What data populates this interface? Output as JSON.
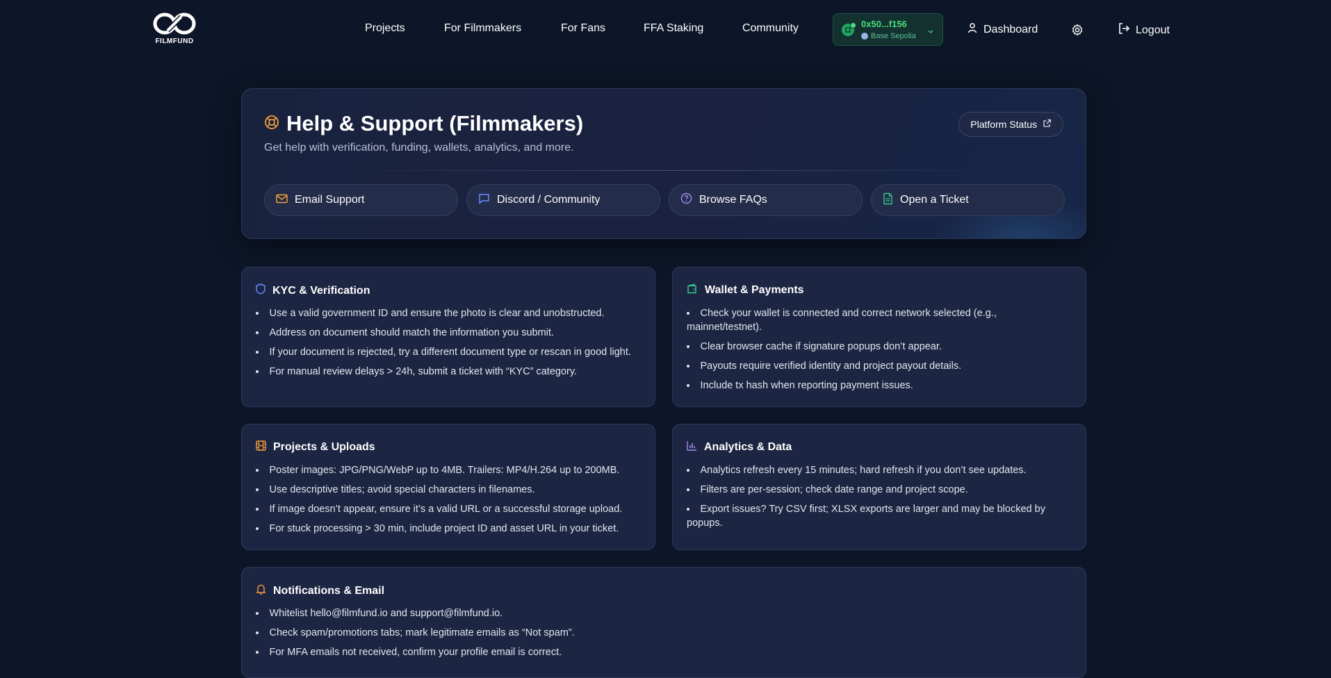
{
  "brand": {
    "logo_text": "FILMFUND"
  },
  "nav": {
    "links": [
      "Projects",
      "For Filmmakers",
      "For Fans",
      "FFA Staking",
      "Community"
    ],
    "wallet": {
      "address": "0x50...f156",
      "network": "Base Sepolia"
    },
    "dashboard_label": "Dashboard",
    "logout_label": "Logout"
  },
  "hero": {
    "title": "Help & Support (Filmmakers)",
    "subtitle": "Get help with verification, funding, wallets, analytics, and more.",
    "status_button": "Platform Status",
    "actions": [
      "Email Support",
      "Discord / Community",
      "Browse FAQs",
      "Open a Ticket"
    ]
  },
  "cards": {
    "kyc": {
      "title": "KYC & Verification",
      "items": [
        "Use a valid government ID and ensure the photo is clear and unobstructed.",
        "Address on document should match the information you submit.",
        "If your document is rejected, try a different document type or rescan in good light.",
        "For manual review delays > 24h, submit a ticket with “KYC” category."
      ]
    },
    "wallet": {
      "title": "Wallet & Payments",
      "items": [
        "Check your wallet is connected and correct network selected (e.g., mainnet/testnet).",
        "Clear browser cache if signature popups don’t appear.",
        "Payouts require verified identity and project payout details.",
        "Include tx hash when reporting payment issues."
      ]
    },
    "projects": {
      "title": "Projects & Uploads",
      "items": [
        "Poster images: JPG/PNG/WebP up to 4MB. Trailers: MP4/H.264 up to 200MB.",
        "Use descriptive titles; avoid special characters in filenames.",
        "If image doesn’t appear, ensure it’s a valid URL or a successful storage upload.",
        "For stuck processing > 30 min, include project ID and asset URL in your ticket."
      ]
    },
    "analytics": {
      "title": "Analytics & Data",
      "items": [
        "Analytics refresh every 15 minutes; hard refresh if you don’t see updates.",
        "Filters are per-session; check date range and project scope.",
        "Export issues? Try CSV first; XLSX exports are larger and may be blocked by popups."
      ]
    },
    "notifications": {
      "title": "Notifications & Email",
      "items": [
        "Whitelist hello@filmfund.io and support@filmfund.io.",
        "Check spam/promotions tabs; mark legitimate emails as “Not spam”.",
        "For MFA emails not received, confirm your profile email is correct."
      ]
    }
  },
  "colors": {
    "background": "#0d1528",
    "card": "#1c2542",
    "wallet_accent": "#4ade80",
    "orange_icon": "#f59e3a",
    "blue_icon": "#6a8cff",
    "green_icon": "#34c88a",
    "purple_icon": "#a78bfa"
  },
  "icons": {
    "hero": "lifebuoy-icon",
    "status": "external-link-icon",
    "email": "mail-icon",
    "discord": "chat-icon",
    "faq": "help-circle-icon",
    "ticket": "file-text-icon",
    "kyc": "shield-icon",
    "wallet": "wallet-icon",
    "projects": "film-icon",
    "analytics": "bar-chart-icon",
    "notifications": "bell-icon",
    "dashboard": "user-icon",
    "settings": "gear-icon",
    "logout": "logout-icon"
  }
}
